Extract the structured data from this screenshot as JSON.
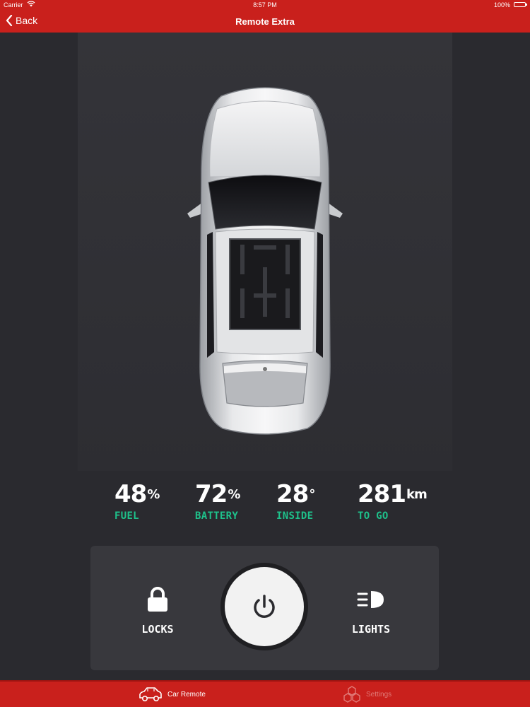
{
  "status_bar": {
    "carrier": "Carrier",
    "time": "8:57 PM",
    "battery": "100%"
  },
  "nav": {
    "back_label": "Back",
    "title": "Remote Extra"
  },
  "stats": [
    {
      "value": "48",
      "unit": "%",
      "label": "FUEL"
    },
    {
      "value": "72",
      "unit": "%",
      "label": "BATTERY"
    },
    {
      "value": "28",
      "unit": "°",
      "label": "INSIDE"
    },
    {
      "value": "281",
      "unit": "km",
      "label": "TO GO"
    }
  ],
  "controls": {
    "locks_label": "LOCKS",
    "lights_label": "LIGHTS",
    "power_icon": "power-icon"
  },
  "tabs": [
    {
      "label": "Car Remote",
      "icon": "car-icon",
      "active": true
    },
    {
      "label": "Settings",
      "icon": "settings-icon",
      "active": false
    }
  ],
  "colors": {
    "brand_red": "#c9201c",
    "accent_green": "#1ec28b",
    "background": "#2a2a2f"
  }
}
